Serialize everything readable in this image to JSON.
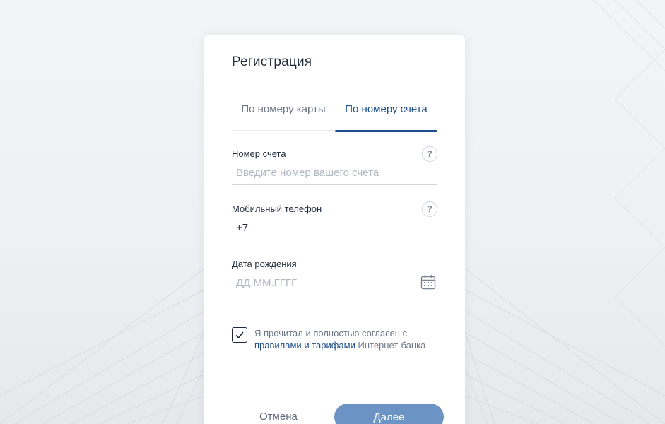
{
  "form": {
    "title": "Регистрация",
    "tabs": [
      {
        "label": "По номеру карты",
        "active": false
      },
      {
        "label": "По номеру счета",
        "active": true
      }
    ],
    "account": {
      "label": "Номер счета",
      "placeholder": "Введите номер вашего счета",
      "value": "",
      "help": "?"
    },
    "phone": {
      "label": "Мобильный телефон",
      "value": "+7",
      "help": "?"
    },
    "birthdate": {
      "label": "Дата рождения",
      "placeholder": "ДД.ММ.ГГГГ",
      "value": "",
      "icon": "calendar-icon"
    },
    "agreement": {
      "checked": true,
      "text_before": "Я прочитал и полностью согласен с",
      "rules_link": "правилами",
      "conjunction": "и",
      "tariffs_link": "тарифами",
      "text_after": "Интернет-банка"
    },
    "cancel_label": "Отмена",
    "next_label": "Далее"
  },
  "colors": {
    "accent": "#1f4f8c",
    "button": "#6b93c4",
    "background": "#eceef1"
  }
}
